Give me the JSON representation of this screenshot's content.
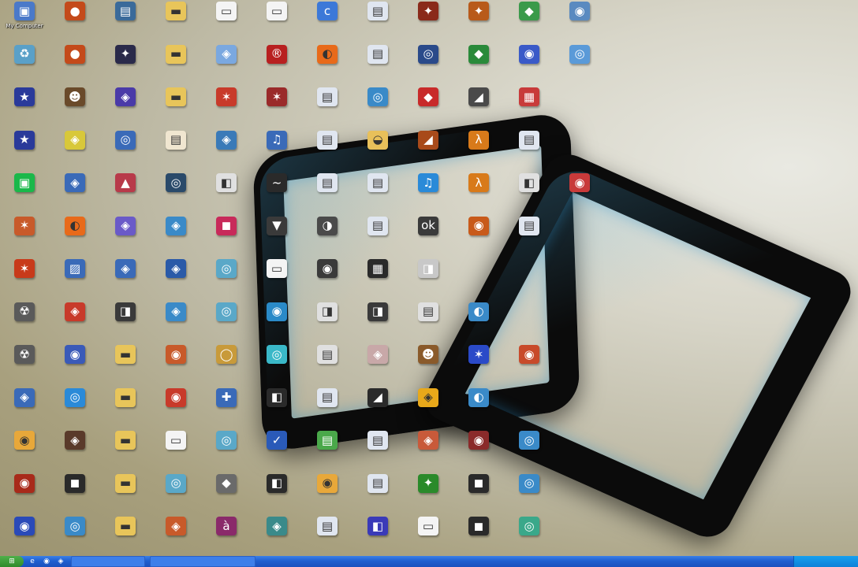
{
  "desktop": {
    "icons": [
      {
        "label": "My Computer",
        "icon": "computer-icon",
        "color": "#4a79c9",
        "glyph": "▣"
      },
      {
        "label": "",
        "icon": "app-icon",
        "color": "#c44a1a",
        "glyph": "●"
      },
      {
        "label": "",
        "icon": "app-icon",
        "color": "#3a6a9a",
        "glyph": "▤"
      },
      {
        "label": "",
        "icon": "folder-icon",
        "color": "#e8c55a",
        "glyph": "▬"
      },
      {
        "label": "",
        "icon": "window-icon",
        "color": "#f4f4f4",
        "glyph": "▭"
      },
      {
        "label": "",
        "icon": "window-icon",
        "color": "#f4f4f4",
        "glyph": "▭"
      },
      {
        "label": "",
        "icon": "app-icon",
        "color": "#3c78d8",
        "glyph": "c"
      },
      {
        "label": "",
        "icon": "document-icon",
        "color": "#e0e6f0",
        "glyph": "▤"
      },
      {
        "label": "",
        "icon": "game-icon",
        "color": "#8a2a1a",
        "glyph": "✦"
      },
      {
        "label": "",
        "icon": "game-icon",
        "color": "#b85a1a",
        "glyph": "✦"
      },
      {
        "label": "",
        "icon": "app-icon",
        "color": "#3a9a4a",
        "glyph": "◆"
      },
      {
        "label": "",
        "icon": "app-icon",
        "color": "#5a8ac0",
        "glyph": "◉"
      },
      {
        "label": "",
        "icon": "recycle-bin-icon",
        "color": "#5aa0c8",
        "glyph": "♻"
      },
      {
        "label": "",
        "icon": "app-icon",
        "color": "#c44a1a",
        "glyph": "●"
      },
      {
        "label": "",
        "icon": "game-icon",
        "color": "#2a2a4a",
        "glyph": "✦"
      },
      {
        "label": "",
        "icon": "folder-icon",
        "color": "#e8c55a",
        "glyph": "▬"
      },
      {
        "label": "",
        "icon": "app-icon",
        "color": "#7aa8e0",
        "glyph": "◈"
      },
      {
        "label": "",
        "icon": "app-icon",
        "color": "#b82020",
        "glyph": "®"
      },
      {
        "label": "",
        "icon": "browser-icon",
        "color": "#e86a1a",
        "glyph": "◐"
      },
      {
        "label": "",
        "icon": "document-icon",
        "color": "#e0e6f0",
        "glyph": "▤"
      },
      {
        "label": "",
        "icon": "app-icon",
        "color": "#2a4a8a",
        "glyph": "◎"
      },
      {
        "label": "",
        "icon": "app-icon",
        "color": "#2a8a3a",
        "glyph": "◆"
      },
      {
        "label": "",
        "icon": "app-icon",
        "color": "#3a5ac8",
        "glyph": "◉"
      },
      {
        "label": "",
        "icon": "app-icon",
        "color": "#5a9ad8",
        "glyph": "◎"
      },
      {
        "label": "",
        "icon": "game-icon",
        "color": "#2a3a9a",
        "glyph": "★"
      },
      {
        "label": "",
        "icon": "game-icon",
        "color": "#6a4a2a",
        "glyph": "☻"
      },
      {
        "label": "",
        "icon": "app-icon",
        "color": "#4a3aa8",
        "glyph": "◈"
      },
      {
        "label": "",
        "icon": "folder-icon",
        "color": "#e8c55a",
        "glyph": "▬"
      },
      {
        "label": "",
        "icon": "app-icon",
        "color": "#c83a2a",
        "glyph": "✶"
      },
      {
        "label": "",
        "icon": "app-icon",
        "color": "#9a2a2a",
        "glyph": "✶"
      },
      {
        "label": "",
        "icon": "document-icon",
        "color": "#e0e6f0",
        "glyph": "▤"
      },
      {
        "label": "",
        "icon": "app-icon",
        "color": "#3a8ac8",
        "glyph": "◎"
      },
      {
        "label": "",
        "icon": "app-icon",
        "color": "#c82a2a",
        "glyph": "◆"
      },
      {
        "label": "",
        "icon": "app-icon",
        "color": "#4a4a4a",
        "glyph": "◢"
      },
      {
        "label": "",
        "icon": "app-icon",
        "color": "#c83a3a",
        "glyph": "▦"
      },
      {
        "label": "",
        "icon": "game-icon",
        "color": "#2a3a9a",
        "glyph": "★"
      },
      {
        "label": "",
        "icon": "app-icon",
        "color": "#d8c83a",
        "glyph": "◈"
      },
      {
        "label": "",
        "icon": "app-icon",
        "color": "#3a6ab8",
        "glyph": "◎"
      },
      {
        "label": "",
        "icon": "document-icon",
        "color": "#f0e6d0",
        "glyph": "▤"
      },
      {
        "label": "",
        "icon": "app-icon",
        "color": "#3a7ab8",
        "glyph": "◈"
      },
      {
        "label": "",
        "icon": "app-icon",
        "color": "#3a6ab8",
        "glyph": "♫"
      },
      {
        "label": "",
        "icon": "document-icon",
        "color": "#e0e6f0",
        "glyph": "▤"
      },
      {
        "label": "",
        "icon": "app-icon",
        "color": "#e8c05a",
        "glyph": "◒"
      },
      {
        "label": "",
        "icon": "game-icon",
        "color": "#a84a1a",
        "glyph": "◢"
      },
      {
        "label": "",
        "icon": "game-icon",
        "color": "#d87a1a",
        "glyph": "λ"
      },
      {
        "label": "",
        "icon": "document-icon",
        "color": "#e0e6f0",
        "glyph": "▤"
      },
      {
        "label": "",
        "icon": "app-icon",
        "color": "#1ab84a",
        "glyph": "▣"
      },
      {
        "label": "",
        "icon": "app-icon",
        "color": "#3a6ab8",
        "glyph": "◈"
      },
      {
        "label": "",
        "icon": "app-icon",
        "color": "#b83a4a",
        "glyph": "▲"
      },
      {
        "label": "",
        "icon": "app-icon",
        "color": "#2a4a6a",
        "glyph": "◎"
      },
      {
        "label": "",
        "icon": "app-icon",
        "color": "#e0e0e0",
        "glyph": "◧"
      },
      {
        "label": "",
        "icon": "app-icon",
        "color": "#2a2a2a",
        "glyph": "~"
      },
      {
        "label": "",
        "icon": "document-icon",
        "color": "#e0e6f0",
        "glyph": "▤"
      },
      {
        "label": "",
        "icon": "document-icon",
        "color": "#e0e6f0",
        "glyph": "▤"
      },
      {
        "label": "",
        "icon": "app-icon",
        "color": "#2a8ad8",
        "glyph": "♫"
      },
      {
        "label": "",
        "icon": "game-icon",
        "color": "#d87a1a",
        "glyph": "λ"
      },
      {
        "label": "",
        "icon": "app-icon",
        "color": "#e0e0e0",
        "glyph": "◧"
      },
      {
        "label": "",
        "icon": "app-icon",
        "color": "#c83a3a",
        "glyph": "◉"
      },
      {
        "label": "",
        "icon": "app-icon",
        "color": "#c85a2a",
        "glyph": "✶"
      },
      {
        "label": "",
        "icon": "browser-icon",
        "color": "#e86a1a",
        "glyph": "◐"
      },
      {
        "label": "",
        "icon": "app-icon",
        "color": "#6a5ac8",
        "glyph": "◈"
      },
      {
        "label": "",
        "icon": "app-icon",
        "color": "#3a8ac8",
        "glyph": "◈"
      },
      {
        "label": "",
        "icon": "app-icon",
        "color": "#c82a5a",
        "glyph": "◼"
      },
      {
        "label": "",
        "icon": "app-icon",
        "color": "#3a3a3a",
        "glyph": "▼"
      },
      {
        "label": "",
        "icon": "app-icon",
        "color": "#4a4a4a",
        "glyph": "◑"
      },
      {
        "label": "",
        "icon": "document-icon",
        "color": "#e0e6f0",
        "glyph": "▤"
      },
      {
        "label": "",
        "icon": "app-icon",
        "color": "#3a3a3a",
        "glyph": "ok"
      },
      {
        "label": "",
        "icon": "app-icon",
        "color": "#c85a1a",
        "glyph": "◉"
      },
      {
        "label": "",
        "icon": "document-icon",
        "color": "#e0e6f0",
        "glyph": "▤"
      },
      {
        "label": "",
        "icon": "game-icon",
        "color": "#c83a1a",
        "glyph": "✶"
      },
      {
        "label": "",
        "icon": "app-icon",
        "color": "#3a6ab8",
        "glyph": "▨"
      },
      {
        "label": "",
        "icon": "app-icon",
        "color": "#3a6ab8",
        "glyph": "◈"
      },
      {
        "label": "",
        "icon": "app-icon",
        "color": "#2a5aa8",
        "glyph": "◈"
      },
      {
        "label": "",
        "icon": "app-icon",
        "color": "#5aa8c8",
        "glyph": "◎"
      },
      {
        "label": "",
        "icon": "window-icon",
        "color": "#f4f4f4",
        "glyph": "▭"
      },
      {
        "label": "",
        "icon": "app-icon",
        "color": "#3a3a3a",
        "glyph": "◉"
      },
      {
        "label": "",
        "icon": "app-icon",
        "color": "#2a2a2a",
        "glyph": "▦"
      },
      {
        "label": "",
        "icon": "app-icon",
        "color": "#c8c8c8",
        "glyph": "◨"
      },
      {
        "label": "",
        "icon": "app-icon",
        "color": "#5a5a5a",
        "glyph": "☢"
      },
      {
        "label": "",
        "icon": "app-icon",
        "color": "#c83a2a",
        "glyph": "◈"
      },
      {
        "label": "",
        "icon": "app-icon",
        "color": "#3a3a3a",
        "glyph": "◨"
      },
      {
        "label": "",
        "icon": "app-icon",
        "color": "#3a8ac8",
        "glyph": "◈"
      },
      {
        "label": "",
        "icon": "app-icon",
        "color": "#5aa8c8",
        "glyph": "◎"
      },
      {
        "label": "",
        "icon": "app-icon",
        "color": "#2a8ac8",
        "glyph": "◉"
      },
      {
        "label": "",
        "icon": "app-icon",
        "color": "#e0e0e0",
        "glyph": "◨"
      },
      {
        "label": "",
        "icon": "app-icon",
        "color": "#3a3a3a",
        "glyph": "◨"
      },
      {
        "label": "",
        "icon": "app-icon",
        "color": "#e0e0e0",
        "glyph": "▤"
      },
      {
        "label": "",
        "icon": "app-icon",
        "color": "#3a8ac8",
        "glyph": "◐"
      },
      {
        "label": "",
        "icon": "app-icon",
        "color": "#5a5a5a",
        "glyph": "☢"
      },
      {
        "label": "",
        "icon": "app-icon",
        "color": "#3a5ab8",
        "glyph": "◉"
      },
      {
        "label": "",
        "icon": "folder-icon",
        "color": "#e8c55a",
        "glyph": "▬"
      },
      {
        "label": "",
        "icon": "app-icon",
        "color": "#c85a2a",
        "glyph": "◉"
      },
      {
        "label": "",
        "icon": "app-icon",
        "color": "#c89a3a",
        "glyph": "◯"
      },
      {
        "label": "",
        "icon": "app-icon",
        "color": "#3ab8c8",
        "glyph": "◎"
      },
      {
        "label": "",
        "icon": "app-icon",
        "color": "#e0e0e0",
        "glyph": "▤"
      },
      {
        "label": "",
        "icon": "app-icon",
        "color": "#c8a8a8",
        "glyph": "◈"
      },
      {
        "label": "",
        "icon": "app-icon",
        "color": "#8a5a2a",
        "glyph": "☻"
      },
      {
        "label": "",
        "icon": "app-icon",
        "color": "#2a4ac8",
        "glyph": "✶"
      },
      {
        "label": "",
        "icon": "app-icon",
        "color": "#c84a2a",
        "glyph": "◉"
      },
      {
        "label": "",
        "icon": "app-icon",
        "color": "#3a6ab8",
        "glyph": "◈"
      },
      {
        "label": "",
        "icon": "app-icon",
        "color": "#2a8ad8",
        "glyph": "◎"
      },
      {
        "label": "",
        "icon": "folder-icon",
        "color": "#e8c55a",
        "glyph": "▬"
      },
      {
        "label": "",
        "icon": "app-icon",
        "color": "#c83a2a",
        "glyph": "◉"
      },
      {
        "label": "",
        "icon": "app-icon",
        "color": "#3a6ab8",
        "glyph": "✚"
      },
      {
        "label": "",
        "icon": "app-icon",
        "color": "#2a2a2a",
        "glyph": "◧"
      },
      {
        "label": "",
        "icon": "document-icon",
        "color": "#e0e6f0",
        "glyph": "▤"
      },
      {
        "label": "",
        "icon": "app-icon",
        "color": "#2a2a2a",
        "glyph": "◢"
      },
      {
        "label": "",
        "icon": "app-icon",
        "color": "#e8a81a",
        "glyph": "◈"
      },
      {
        "label": "",
        "icon": "app-icon",
        "color": "#3a8ac8",
        "glyph": "◐"
      },
      {
        "label": "",
        "icon": "app-icon",
        "color": "#e8a83a",
        "glyph": "◉"
      },
      {
        "label": "",
        "icon": "app-icon",
        "color": "#5a3a2a",
        "glyph": "◈"
      },
      {
        "label": "",
        "icon": "folder-icon",
        "color": "#e8c55a",
        "glyph": "▬"
      },
      {
        "label": "",
        "icon": "window-icon",
        "color": "#f4f4f4",
        "glyph": "▭"
      },
      {
        "label": "",
        "icon": "app-icon",
        "color": "#5aa8c8",
        "glyph": "◎"
      },
      {
        "label": "",
        "icon": "app-icon",
        "color": "#2a5ab8",
        "glyph": "✓"
      },
      {
        "label": "",
        "icon": "app-icon",
        "color": "#4aa84a",
        "glyph": "▤"
      },
      {
        "label": "",
        "icon": "document-icon",
        "color": "#e0e6f0",
        "glyph": "▤"
      },
      {
        "label": "",
        "icon": "app-icon",
        "color": "#c85a3a",
        "glyph": "◈"
      },
      {
        "label": "",
        "icon": "app-icon",
        "color": "#8a2a2a",
        "glyph": "◉"
      },
      {
        "label": "",
        "icon": "app-icon",
        "color": "#3a8ac8",
        "glyph": "◎"
      },
      {
        "label": "",
        "icon": "app-icon",
        "color": "#a82a1a",
        "glyph": "◉"
      },
      {
        "label": "",
        "icon": "app-icon",
        "color": "#2a2a2a",
        "glyph": "◼"
      },
      {
        "label": "",
        "icon": "folder-icon",
        "color": "#e8c55a",
        "glyph": "▬"
      },
      {
        "label": "",
        "icon": "app-icon",
        "color": "#5aa8c8",
        "glyph": "◎"
      },
      {
        "label": "",
        "icon": "app-icon",
        "color": "#6a6a6a",
        "glyph": "◆"
      },
      {
        "label": "",
        "icon": "app-icon",
        "color": "#2a2a2a",
        "glyph": "◧"
      },
      {
        "label": "",
        "icon": "app-icon",
        "color": "#e8a83a",
        "glyph": "◉"
      },
      {
        "label": "",
        "icon": "document-icon",
        "color": "#e0e6f0",
        "glyph": "▤"
      },
      {
        "label": "",
        "icon": "app-icon",
        "color": "#2a8a2a",
        "glyph": "✦"
      },
      {
        "label": "",
        "icon": "app-icon",
        "color": "#2a2a2a",
        "glyph": "◼"
      },
      {
        "label": "",
        "icon": "app-icon",
        "color": "#3a8ac8",
        "glyph": "◎"
      },
      {
        "label": "",
        "icon": "app-icon",
        "color": "#2a4ab8",
        "glyph": "◉"
      },
      {
        "label": "",
        "icon": "app-icon",
        "color": "#3a8ac8",
        "glyph": "◎"
      },
      {
        "label": "",
        "icon": "folder-icon",
        "color": "#e8c55a",
        "glyph": "▬"
      },
      {
        "label": "",
        "icon": "app-icon",
        "color": "#c85a2a",
        "glyph": "◈"
      },
      {
        "label": "",
        "icon": "app-icon",
        "color": "#8a2a6a",
        "glyph": "à"
      },
      {
        "label": "",
        "icon": "app-icon",
        "color": "#3a8a8a",
        "glyph": "◈"
      },
      {
        "label": "",
        "icon": "document-icon",
        "color": "#e0e6f0",
        "glyph": "▤"
      },
      {
        "label": "",
        "icon": "app-icon",
        "color": "#3a3ab8",
        "glyph": "◧"
      },
      {
        "label": "",
        "icon": "window-icon",
        "color": "#f4f4f4",
        "glyph": "▭"
      },
      {
        "label": "",
        "icon": "app-icon",
        "color": "#2a2a2a",
        "glyph": "◼"
      },
      {
        "label": "",
        "icon": "app-icon",
        "color": "#3aa88a",
        "glyph": "◎"
      }
    ]
  },
  "taskbar": {
    "start_glyph": "⊞",
    "quick_launch": [
      "e",
      "◉",
      "◈"
    ],
    "tasks": [
      "",
      ""
    ],
    "clock": ""
  }
}
